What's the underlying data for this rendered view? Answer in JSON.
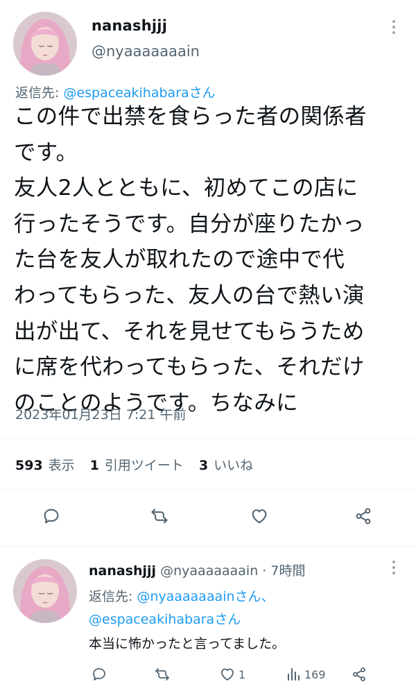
{
  "main_tweet": {
    "display_name": "nanashjjj",
    "handle": "@nyaaaaaaain",
    "replying_to_label": "返信先: ",
    "replying_to_mention": "@espaceakihabara",
    "replying_to_suffix": "さん",
    "text_lines": [
      "この件で出禁を食らった者の関係者",
      "です。",
      "友人2人とともに、初めてこの店に",
      "行ったそうです。自分が座りたかっ",
      "た台を友人が取れたので途中で代",
      "わってもらった、友人の台で熱い演",
      "出が出て、それを見せてもらうため",
      "に席を代わってもらった、それだけ",
      "のことのようです。ちなみに"
    ],
    "timestamp": "2023年01月23日 7:21 午前",
    "stats": {
      "views_count": "593",
      "views_label": "表示",
      "quotes_count": "1",
      "quotes_label": "引用ツイート",
      "likes_count": "3",
      "likes_label": "いいね"
    },
    "actions": [
      "reply-icon",
      "retweet-icon",
      "like-icon",
      "share-icon"
    ]
  },
  "reply_tweet": {
    "display_name": "nanashjjj",
    "handle_time": "@nyaaaaaaain · 7時間",
    "replying_to_label": "返信先: ",
    "mention_1": "@nyaaaaaaain",
    "suffix_1": "さん、",
    "mention_2": "@espaceakihabara",
    "suffix_2": "さん",
    "text": "本当に怖かったと言ってました。",
    "like_count": "1",
    "view_count": "169",
    "actions": [
      "reply-icon",
      "retweet-icon",
      "like-icon",
      "views-icon",
      "share-icon"
    ]
  },
  "colors": {
    "accent": "#1d9bf0",
    "secondary_text": "#536471",
    "primary_text": "#0f1419"
  }
}
